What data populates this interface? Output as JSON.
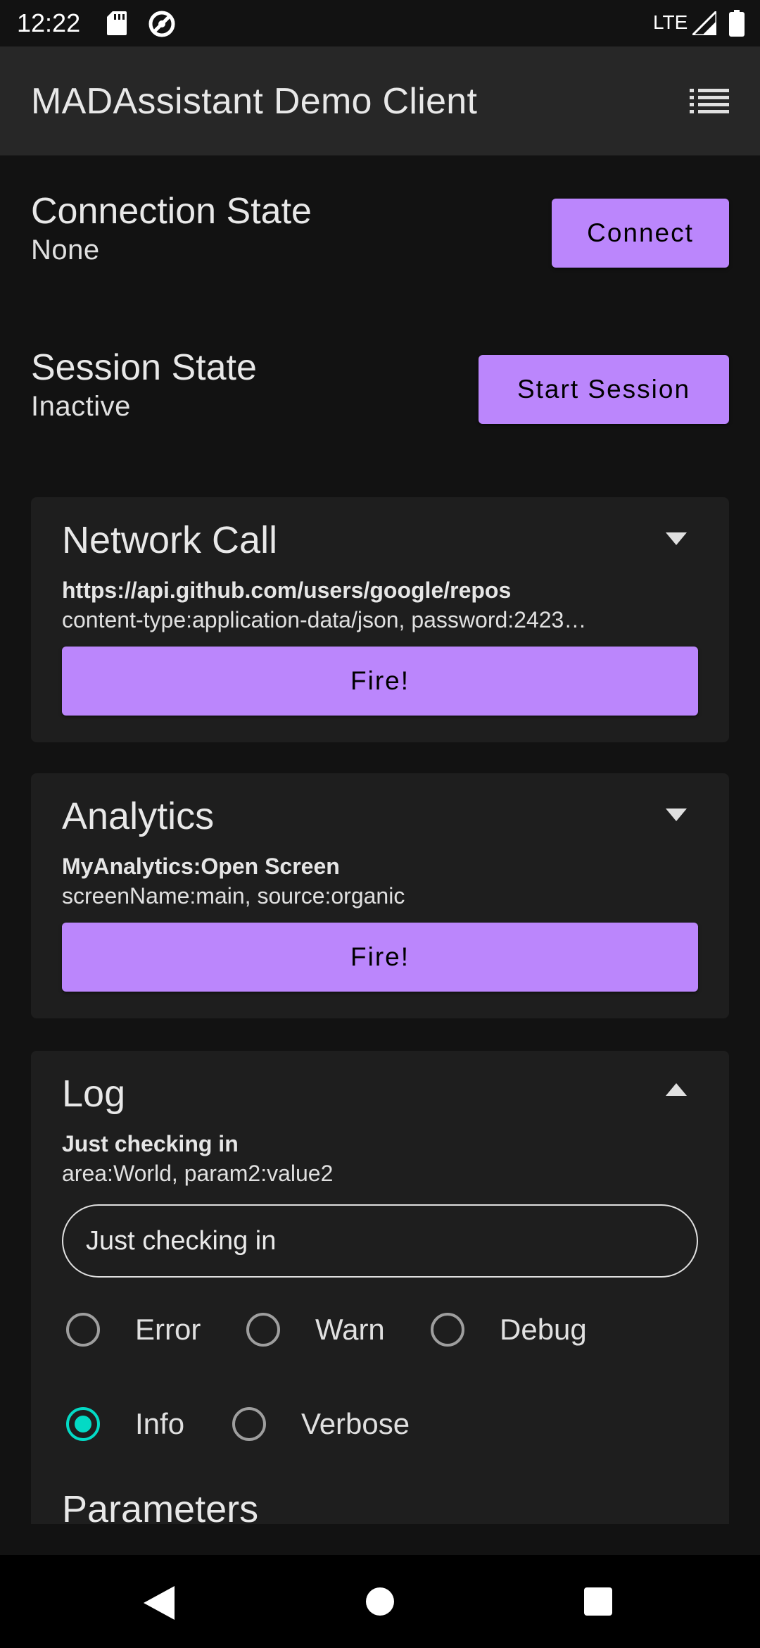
{
  "status_bar": {
    "time": "12:22",
    "network": "LTE",
    "icons": [
      "sd-card-icon",
      "sync-icon",
      "signal-icon",
      "battery-icon"
    ]
  },
  "app_bar": {
    "title": "MADAssistant Demo Client",
    "menu_icon": "list-menu-icon"
  },
  "connection": {
    "title": "Connection State",
    "value": "None",
    "button_label": "Connect"
  },
  "session": {
    "title": "Session State",
    "value": "Inactive",
    "button_label": "Start Session"
  },
  "network_card": {
    "title": "Network Call",
    "url": "https://api.github.com/users/google/repos",
    "params": "content-type:application-data/json, password:2423…",
    "button_label": "Fire!",
    "expanded": false
  },
  "analytics_card": {
    "title": "Analytics",
    "event": "MyAnalytics:Open Screen",
    "params": "screenName:main, source:organic",
    "button_label": "Fire!",
    "expanded": false
  },
  "log_card": {
    "title": "Log",
    "message": "Just checking in",
    "params": "area:World, param2:value2",
    "input_value": "Just checking in",
    "levels": [
      {
        "label": "Error",
        "checked": false
      },
      {
        "label": "Warn",
        "checked": false
      },
      {
        "label": "Debug",
        "checked": false
      },
      {
        "label": "Info",
        "checked": true
      },
      {
        "label": "Verbose",
        "checked": false
      }
    ],
    "parameters_title": "Parameters",
    "expanded": true
  },
  "colors": {
    "accent": "#bb86fc",
    "radio_checked": "#03dac5",
    "background": "#121212",
    "card": "#1e1e1e",
    "app_bar": "#272727"
  }
}
